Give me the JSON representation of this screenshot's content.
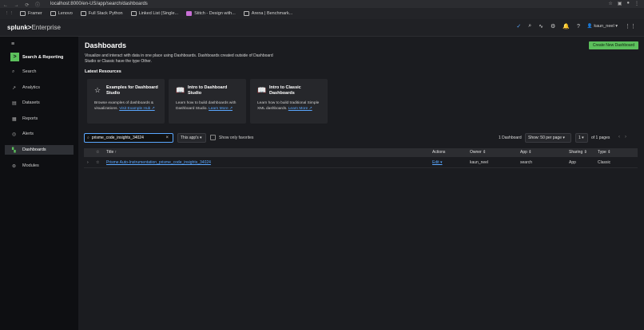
{
  "browser": {
    "url": "localhost:8000/en-US/app/search/dashboards",
    "nav_glyphs": "← → ⟳ ⓘ",
    "bookmarks": [
      "Framer",
      "Lenovo",
      "Full Stack Python",
      "Linked List (Single...",
      "Stitch - Design with...",
      "Arena | Benchmark..."
    ]
  },
  "topnav": {
    "logo_brand": "splunk>",
    "logo_product": "Enterprise",
    "user": "kaun_neel"
  },
  "sidebar": {
    "app_name": "Search & Reporting",
    "items": [
      {
        "label": "Search",
        "icon": "search-icon"
      },
      {
        "label": "Analytics",
        "icon": "analytics-icon"
      },
      {
        "label": "Datasets",
        "icon": "datasets-icon"
      },
      {
        "label": "Reports",
        "icon": "reports-icon"
      },
      {
        "label": "Alerts",
        "icon": "alerts-icon"
      },
      {
        "label": "Dashboards",
        "icon": "dashboards-icon"
      },
      {
        "label": "Modules",
        "icon": "modules-icon"
      }
    ]
  },
  "main": {
    "title": "Dashboards",
    "description": "Visualize and interact with data in one place using Dashboards. Dashboards created outside of Dashboard Studio or Classic have the type Other.",
    "create_button": "Create New Dashboard",
    "latest_resources": "Latest Resources",
    "cards": [
      {
        "title": "Examples for Dashboard Studio",
        "desc": "Browse examples of dashboards & visualizations.",
        "link": "Visit Example Hub ↗"
      },
      {
        "title": "Intro to Dashboard Studio",
        "desc": "Learn how to build dashboards with Dashboard Studio.",
        "link": "Learn More ↗"
      },
      {
        "title": "Intro to Classic Dashboards",
        "desc": "Learn how to build traditional Simple XML dashboards.",
        "link": "Learn More ↗"
      }
    ],
    "search": {
      "value": "prisme_code_insights_34024"
    },
    "filter": "This app's ▾",
    "favorites_label": "Show only favorites",
    "count": "1 Dashboard",
    "per_page": "Show: 50 per page ▾",
    "page": "1 ▾",
    "of_pages": "of 1 pages"
  },
  "table": {
    "headers": {
      "title": "Title ↑",
      "actions": "Actions",
      "owner": "Owner ⇕",
      "app": "App ⇕",
      "sharing": "Sharing ⇕",
      "type": "Type ⇕"
    },
    "rows": [
      {
        "title": "Prisme Auto-Instrumentation_prisme_code_insights_34024",
        "actions": "Edit ▾",
        "owner": "kaun_neel",
        "app": "search",
        "sharing": "App",
        "type": "Classic"
      }
    ]
  }
}
